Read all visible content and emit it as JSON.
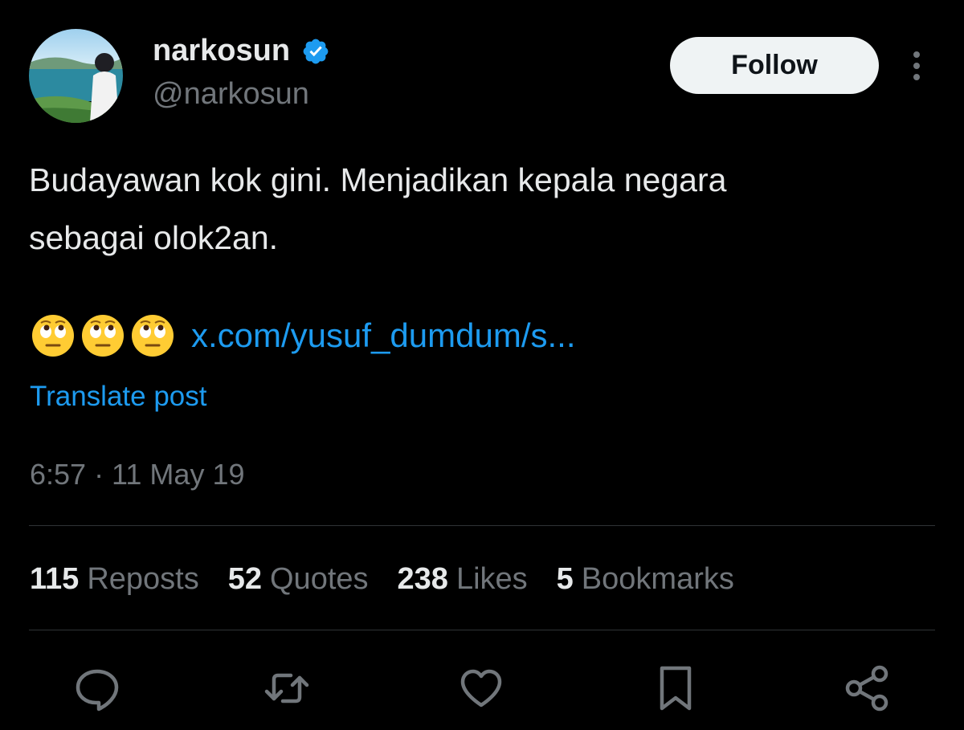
{
  "author": {
    "display_name": "narkosun",
    "handle": "@narkosun",
    "avatar_icon": "avatar-photo-icon",
    "verified_icon": "verified-badge-icon"
  },
  "follow_label": "Follow",
  "more_icon": "more-options-icon",
  "tweet": {
    "text": "Budayawan kok gini. Menjadikan kepala negara\nsebagai olok2an.",
    "emojis": [
      "🙄",
      "🙄",
      "🙄"
    ],
    "link": "x.com/yusuf_dumdum/s..."
  },
  "translate_label": "Translate post",
  "timestamp": "6:57 · 11 May 19",
  "stats": [
    {
      "count": "115",
      "label": "Reposts"
    },
    {
      "count": "52",
      "label": "Quotes"
    },
    {
      "count": "238",
      "label": "Likes"
    },
    {
      "count": "5",
      "label": "Bookmarks"
    }
  ],
  "actions": [
    "reply-icon",
    "repost-icon",
    "like-icon",
    "bookmark-icon",
    "share-icon"
  ],
  "colors": {
    "background": "#000000",
    "text": "#e7e9ea",
    "muted": "#71767b",
    "accent": "#1d9bf0",
    "divider": "#2f3336"
  }
}
